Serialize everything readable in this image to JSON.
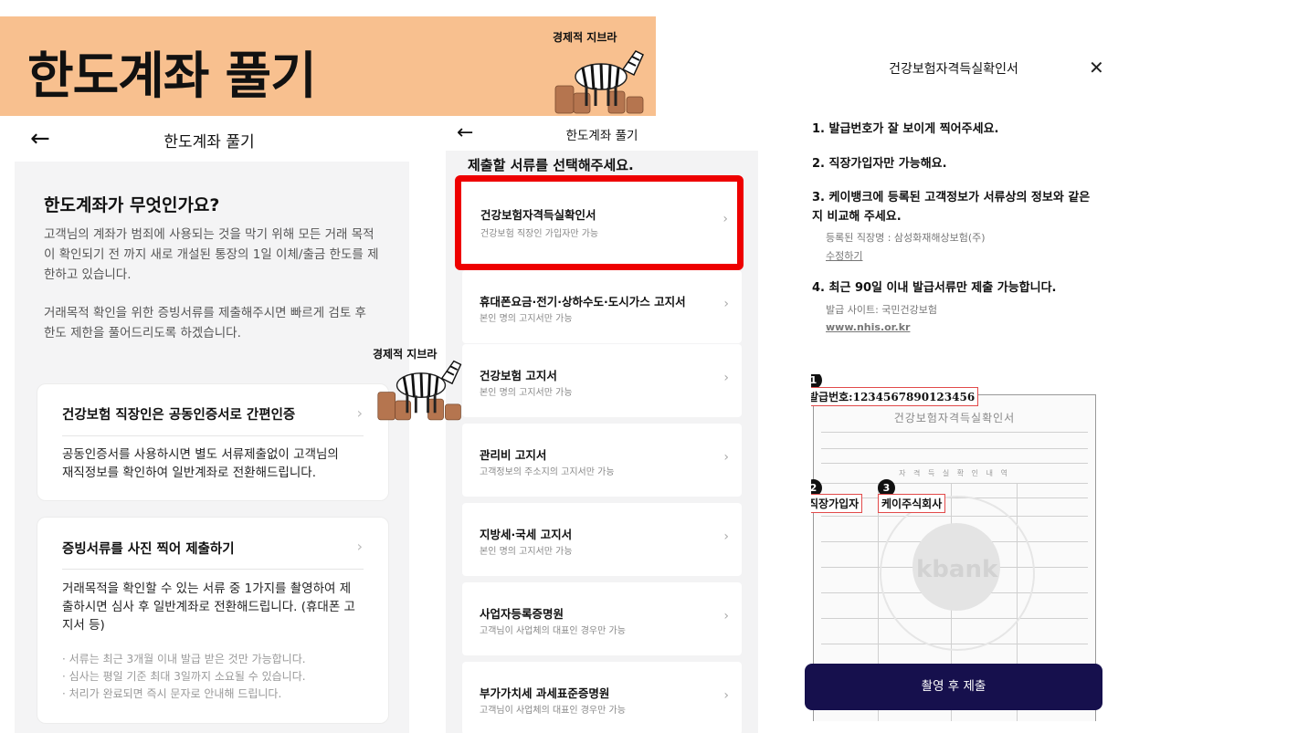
{
  "banner": {
    "title": "한도계좌 풀기",
    "brand": "경제적 지브라"
  },
  "overlay_brand": "경제적 지브라",
  "screen1": {
    "nav_title": "한도계좌 풀기",
    "heading": "한도계좌가 무엇인가요?",
    "paragraph1": "고객님의 계좌가 범죄에 사용되는 것을 막기 위해 모든 거래 목적\n이 확인되기 전 까지 새로 개설된 통장의 1일 이체/출금 한도를 제\n한하고 있습니다.",
    "paragraph2": "거래목적 확인을 위한 증빙서류를 제출해주시면 빠르게 검토 후\n한도 제한을 풀어드리도록 하겠습니다.",
    "card1": {
      "title": "건강보험 직장인은 공동인증서로 간편인증",
      "text": "공동인증서를 사용하시면 별도 서류제출없이 고객님의\n재직정보를 확인하여 일반계좌로 전환해드립니다."
    },
    "card2": {
      "title": "증빙서류를 사진 찍어 제출하기",
      "text": "거래목적을 확인할 수 있는 서류 중 1가지를 촬영하여 제\n출하시면 심사 후 일반계좌로 전환해드립니다. (휴대폰 고\n지서 등)",
      "notes": [
        "· 서류는 최근 3개월 이내 발급 받은 것만 가능합니다.",
        "· 심사는 평일 기준 최대 3일까지 소요될 수 있습니다.",
        "· 처리가 완료되면 즉시 문자로 안내해 드립니다."
      ]
    }
  },
  "screen2": {
    "nav_title": "한도계좌 풀기",
    "heading": "제출할 서류를 선택해주세요.",
    "items": [
      {
        "name": "건강보험자격득실확인서",
        "sub": "건강보험 직장인 가입자만 가능",
        "selected": true
      },
      {
        "name": "휴대폰요금·전기·상하수도·도시가스 고지서",
        "sub": "본인 명의 고지서만 가능"
      },
      {
        "name": "건강보험 고지서",
        "sub": "본인 명의 고지서만 가능"
      },
      {
        "name": "관리비 고지서",
        "sub": "고객정보의 주소지의 고지서만 가능"
      },
      {
        "name": "지방세·국세 고지서",
        "sub": "본인 명의 고지서만 가능"
      },
      {
        "name": "사업자등록증명원",
        "sub": "고객님이 사업체의 대표인 경우만 가능"
      },
      {
        "name": "부가가치세 과세표준증명원",
        "sub": "고객님이 사업체의 대표인 경우만 가능"
      }
    ]
  },
  "screen3": {
    "title": "건강보험자격득실확인서",
    "rules": [
      "1. 발급번호가 잘 보이게 찍어주세요.",
      "2. 직장가입자만 가능해요.",
      "3. 케이뱅크에 등록된 고객정보가 서류상의 정보와 같은\n    지 비교해 주세요.",
      "4. 최근 90일 이내 발급서류만 제출 가능합니다."
    ],
    "registered_employer": "등록된 직장명 : 삼성화재해상보험(주)",
    "edit_link": "수정하기",
    "issue_site": "발급 사이트: 국민건강보험",
    "site_url": "www.nhis.or.kr",
    "sample": {
      "paper_title": "건강보험자격득실확인서",
      "section": "자 격 득 실 확 인 내 역",
      "callouts": {
        "issue_no": "발급번호:1234567890123456",
        "member_type": "직장가입자",
        "company": "케이주식회사"
      },
      "badges": [
        "1",
        "2",
        "3"
      ],
      "watermark": "kbank"
    },
    "submit_label": "촬영 후 제출"
  },
  "colors": {
    "banner_bg": "#f8c08f",
    "highlight": "#ee0000",
    "submit_bg": "#16104d",
    "callout": "#e24a4a"
  },
  "icons": [
    "back-arrow-icon",
    "chevron-right-icon",
    "close-icon",
    "zebra-coins-logo"
  ]
}
